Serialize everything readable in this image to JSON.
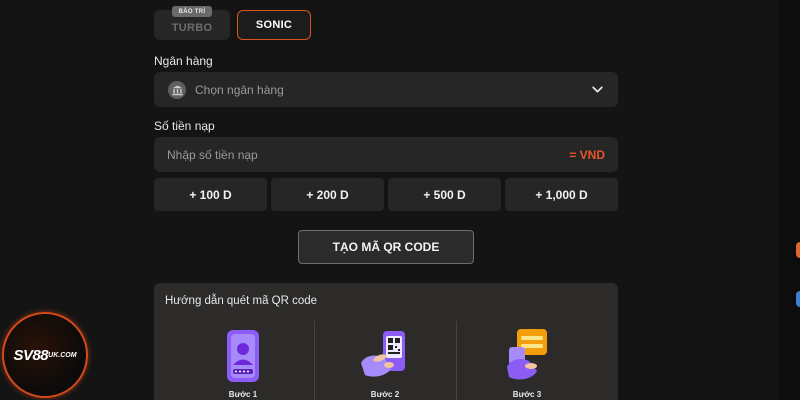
{
  "tabs": {
    "turbo": {
      "label": "TURBO",
      "badge": "BẢO TRÌ"
    },
    "sonic": {
      "label": "SONIC"
    }
  },
  "bank": {
    "label": "Ngân hàng",
    "placeholder": "Chọn ngân hàng",
    "icon": "bank-icon"
  },
  "amount": {
    "label": "Số tiền nạp",
    "placeholder": "Nhập số tiền nạp",
    "currency": "= VND"
  },
  "quick_amounts": [
    "+ 100 D",
    "+ 200 D",
    "+ 500 D",
    "+ 1,000 D"
  ],
  "qr_button": "TẠO MÃ QR CODE",
  "guide": {
    "title": "Hướng dẫn quét mã QR code",
    "steps": [
      {
        "label": "Bước 1",
        "icon": "id-card-icon"
      },
      {
        "label": "Bước 2",
        "icon": "phone-qr-icon"
      },
      {
        "label": "Bước 3",
        "icon": "payment-card-icon"
      }
    ]
  },
  "logo": {
    "main": "SV88",
    "sub": "UK.COM"
  },
  "colors": {
    "accent": "#e8552a",
    "background": "#141414",
    "surface": "#262626",
    "guide_bg": "#2d2b29",
    "icon_purple": "#8b5cf6"
  }
}
